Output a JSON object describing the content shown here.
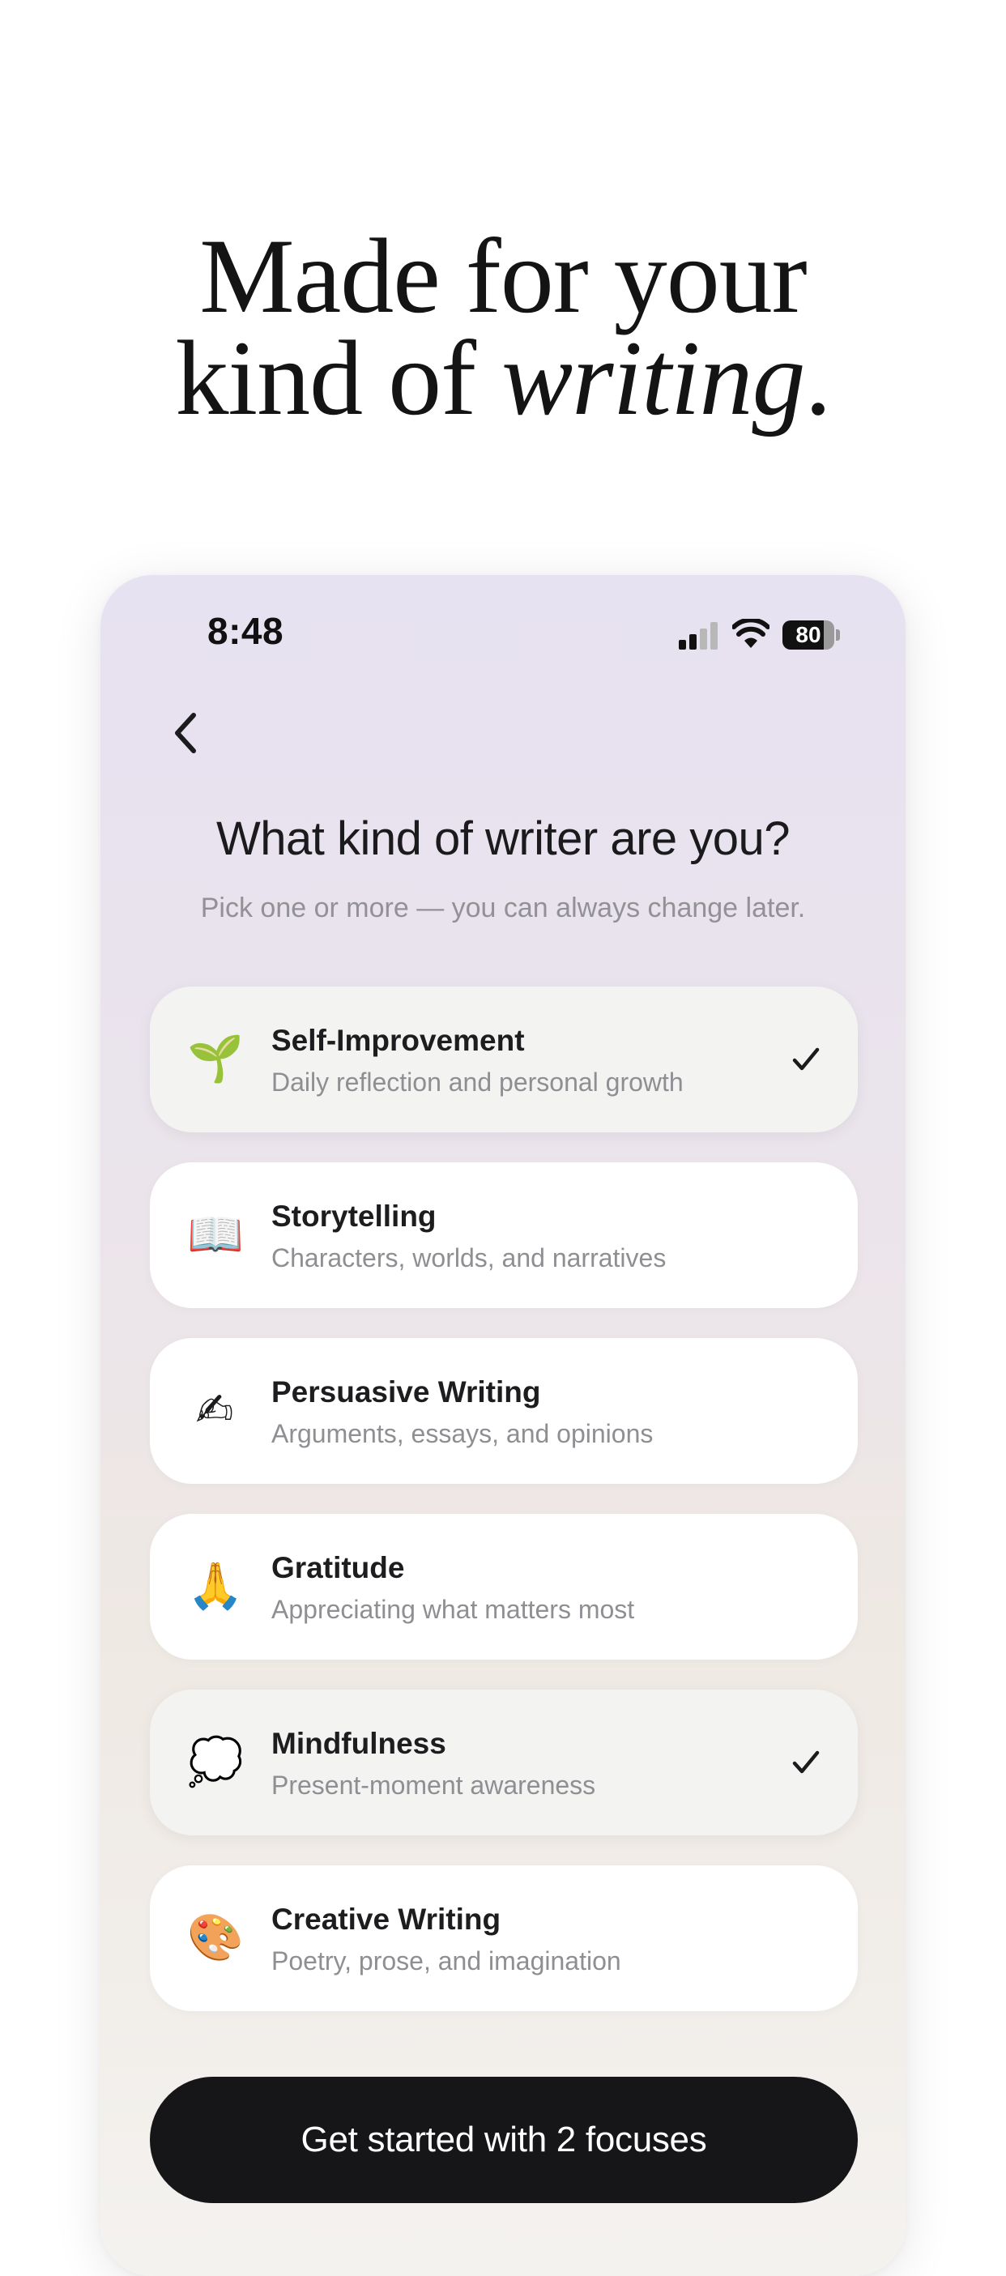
{
  "hero": {
    "line1": "Made for your",
    "line2_prefix": "kind of ",
    "line2_emphasis": "writing",
    "line2_suffix": "."
  },
  "status_bar": {
    "time": "8:48",
    "battery_level": "80",
    "icons": [
      "signal-icon",
      "wifi-icon",
      "battery-icon"
    ]
  },
  "nav": {
    "back_icon": "chevron-left-icon"
  },
  "screen": {
    "title": "What kind of writer are you?",
    "subtitle": "Pick one or more — you can always change later."
  },
  "options": [
    {
      "emoji": "🌱",
      "icon": "seedling-icon",
      "title": "Self-Improvement",
      "description": "Daily reflection and personal growth",
      "selected": true
    },
    {
      "emoji": "📖",
      "icon": "open-book-icon",
      "title": "Storytelling",
      "description": "Characters, worlds, and narratives",
      "selected": false
    },
    {
      "emoji": "✍",
      "icon": "writing-hand-icon",
      "title": "Persuasive Writing",
      "description": "Arguments, essays, and opinions",
      "selected": false
    },
    {
      "emoji": "🙏",
      "icon": "folded-hands-icon",
      "title": "Gratitude",
      "description": "Appreciating what matters most",
      "selected": false
    },
    {
      "emoji": "💭",
      "icon": "thought-bubble-icon",
      "title": "Mindfulness",
      "description": "Present-moment awareness",
      "selected": true
    },
    {
      "emoji": "🎨",
      "icon": "artist-palette-icon",
      "title": "Creative Writing",
      "description": "Poetry, prose, and imagination",
      "selected": false
    }
  ],
  "cta": {
    "label": "Get started with 2 focuses"
  },
  "colors": {
    "accent_dark": "#161618",
    "selected_card": "#f3f3f2",
    "card": "#ffffff",
    "muted_text": "#8e8e93"
  }
}
